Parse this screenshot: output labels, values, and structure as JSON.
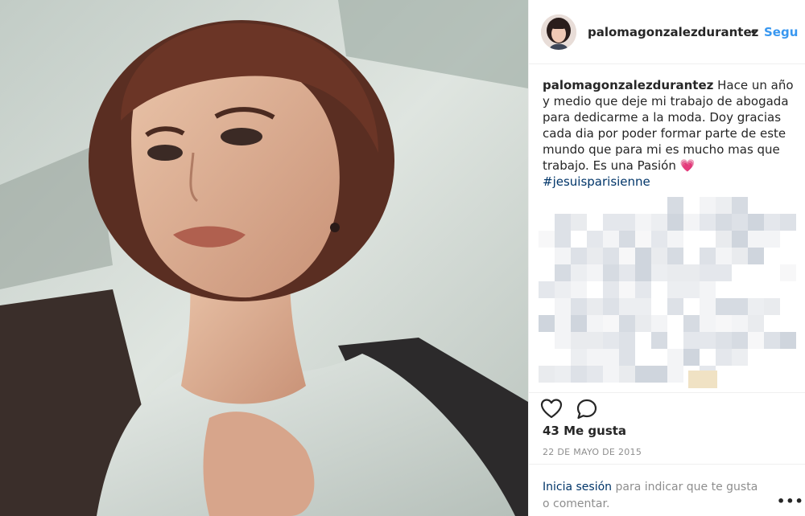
{
  "post": {
    "username": "palomagonzalezdurantez",
    "dot": "•",
    "follow_label": "Segu",
    "caption": {
      "username": "palomagonzalezdurantez",
      "text": "Hace un año y medio que deje mi trabajo de abogada para dedicarme a la moda. Doy gracias cada dia por poder formar parte de este mundo que para mi es mucho mas que trabajo. Es una Pasión",
      "emoji": "💗",
      "hashtag": "#jesuisparisienne"
    },
    "likes": "43 Me gusta",
    "date": "22 DE MAYO DE 2015",
    "login_prompt": {
      "link": "Inicia sesión",
      "text": " para indicar que te gusta o comentar."
    },
    "more_label": "•••"
  },
  "icons": {
    "like": "heart-icon",
    "comment": "comment-icon",
    "more": "more-options-icon"
  },
  "colors": {
    "link_blue": "#3897f0",
    "hashtag_blue": "#003569",
    "muted_gray": "#8e8e8e",
    "text": "#262626"
  }
}
